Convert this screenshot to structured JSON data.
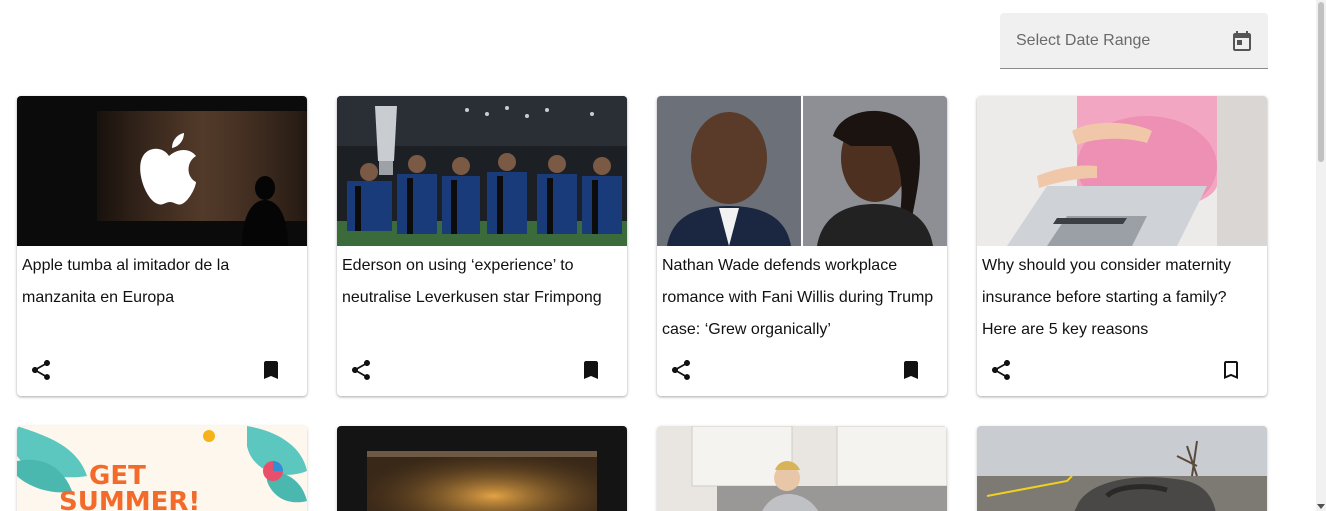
{
  "date_filter": {
    "placeholder": "Select Date Range",
    "icon": "calendar-icon"
  },
  "articles": [
    {
      "title": "Apple tumba al imitador de la manzanita en Europa",
      "image": "apple-logo-store-photo",
      "bookmarked": true
    },
    {
      "title": "Ederson on using ‘experience’ to neutralise Leverkusen star Frimpong",
      "image": "football-trophy-celebration-photo",
      "bookmarked": true
    },
    {
      "title": "Nathan Wade defends workplace romance with Fani Willis during Trump case: ‘Grew organically’",
      "image": "two-portraits-photo",
      "bookmarked": true
    },
    {
      "title": "Why should you consider maternity insurance before starting a family? Here are 5 key reasons",
      "image": "pregnant-woman-laptop-photo",
      "bookmarked": false
    }
  ],
  "second_row": [
    {
      "image": "get-summer-banner",
      "banner_text": [
        "GET",
        "SUMMER!"
      ]
    },
    {
      "image": "screen-display-photo"
    },
    {
      "image": "man-on-sofa-photo"
    },
    {
      "image": "wrecked-car-photo"
    }
  ],
  "colors": {
    "bookmark_filled": "#000000",
    "accent_orange": "#f26b2a",
    "field_bg": "#f0f0f0"
  }
}
